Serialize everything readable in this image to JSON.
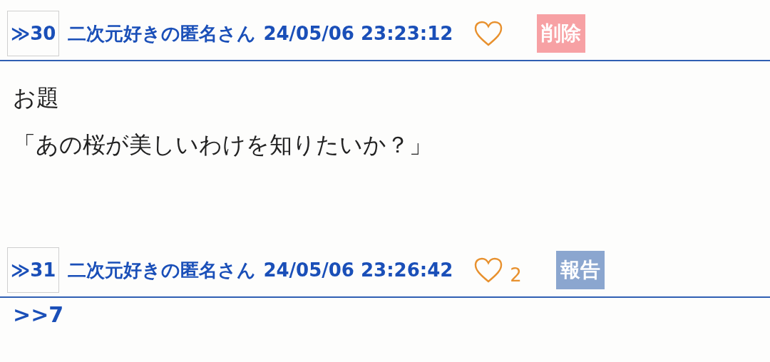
{
  "posts": [
    {
      "number": "≫30",
      "name": "二次元好きの匿名さん",
      "date": "24/05/06 23:23:12",
      "action": {
        "kind": "delete",
        "label": "削除"
      },
      "body": [
        {
          "kind": "text",
          "text": "お題"
        },
        {
          "kind": "text",
          "text": "「あの桜が美しいわけを知りたいか？」"
        }
      ]
    },
    {
      "number": "≫31",
      "name": "二次元好きの匿名さん",
      "date": "24/05/06 23:26:42",
      "like_count": "2",
      "action": {
        "kind": "report",
        "label": "報告"
      },
      "body": [
        {
          "kind": "anchor",
          "text": ">>7"
        }
      ]
    }
  ]
}
